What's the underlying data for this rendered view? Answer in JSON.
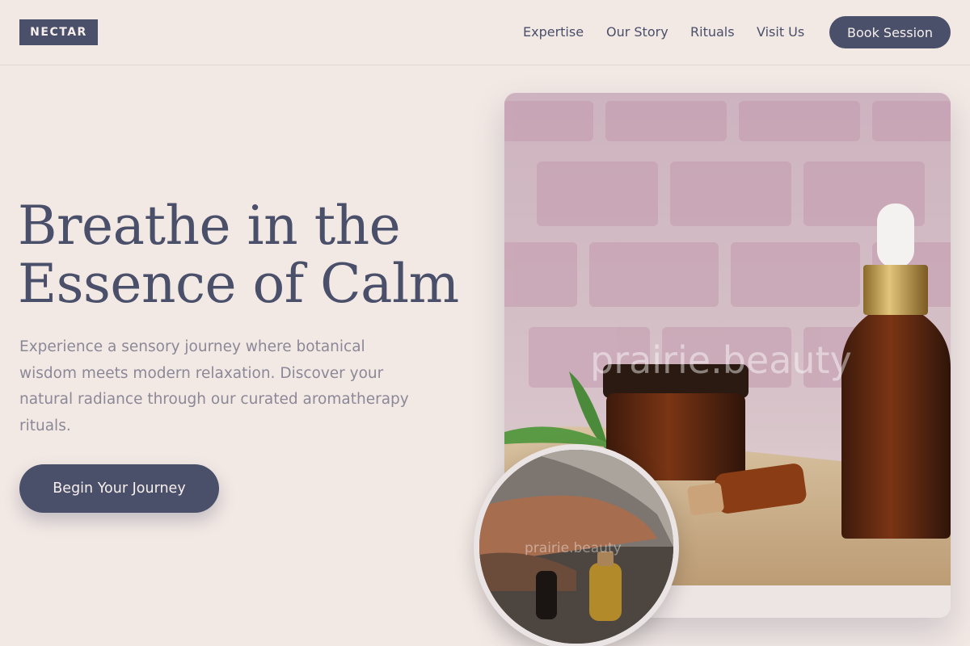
{
  "header": {
    "logo": "NECTAR",
    "nav": [
      "Expertise",
      "Our Story",
      "Rituals",
      "Visit Us"
    ],
    "book_label": "Book Session"
  },
  "hero": {
    "headline_line1": "Breathe in the",
    "headline_line2": "Essence of Calm",
    "subtext": "Experience a sensory journey where botanical wisdom meets modern relaxation. Discover your natural radiance through our curated aromatherapy rituals.",
    "cta_label": "Begin Your Journey"
  },
  "images": {
    "main_watermark": "prairie.beauty",
    "circle_watermark": "prairie.beauty"
  },
  "colors": {
    "background": "#f2e8e4",
    "accent": "#4a4f6a",
    "muted_text": "#8b8897"
  }
}
